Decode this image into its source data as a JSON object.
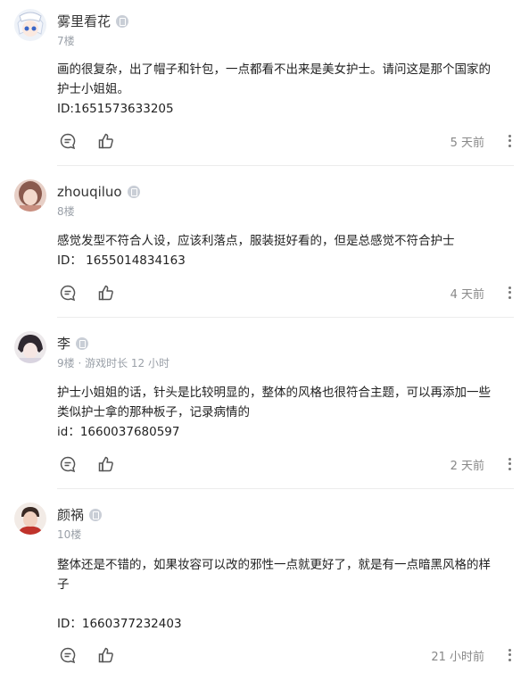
{
  "comments": [
    {
      "author": "雾里看花",
      "meta": "7楼",
      "body": "画的很复杂，出了帽子和针包，一点都看不出来是美女护士。请问这是那个国家的\n护士小姐姐。\nID:1651573633205",
      "time": "5 天前",
      "avatar_colors": [
        "#e8eef8",
        "#3a66c7"
      ]
    },
    {
      "author": "zhouqiluo",
      "meta": "8楼",
      "body": "感觉发型不符合人设，应该利落点，服装挺好看的，但是总感觉不符合护士\nID： 1655014834163",
      "time": "4 天前",
      "avatar_colors": [
        "#d9b3a4",
        "#7a4c40"
      ]
    },
    {
      "author": "李",
      "meta": "9楼 · 游戏时长 12 小时",
      "body": "护士小姐姐的话，针头是比较明显的，整体的风格也很符合主题，可以再添加一些\n类似护士拿的那种板子，记录病情的\nid：1660037680597",
      "time": "2 天前",
      "avatar_colors": [
        "#e9e4e6",
        "#3b2f36"
      ]
    },
    {
      "author": "颜祸",
      "meta": "10楼",
      "body": "整体还是不错的，如果妆容可以改的邪性一点就更好了，就是有一点暗黑风格的样\n子\n\nID：1660377232403",
      "time": "21 小时前",
      "avatar_colors": [
        "#f1e7e1",
        "#c0332b"
      ]
    }
  ],
  "icons": {
    "reply": "comment-icon",
    "like": "thumbs-up-icon",
    "more": "more-vertical-icon",
    "badge": "device-badge-icon"
  }
}
